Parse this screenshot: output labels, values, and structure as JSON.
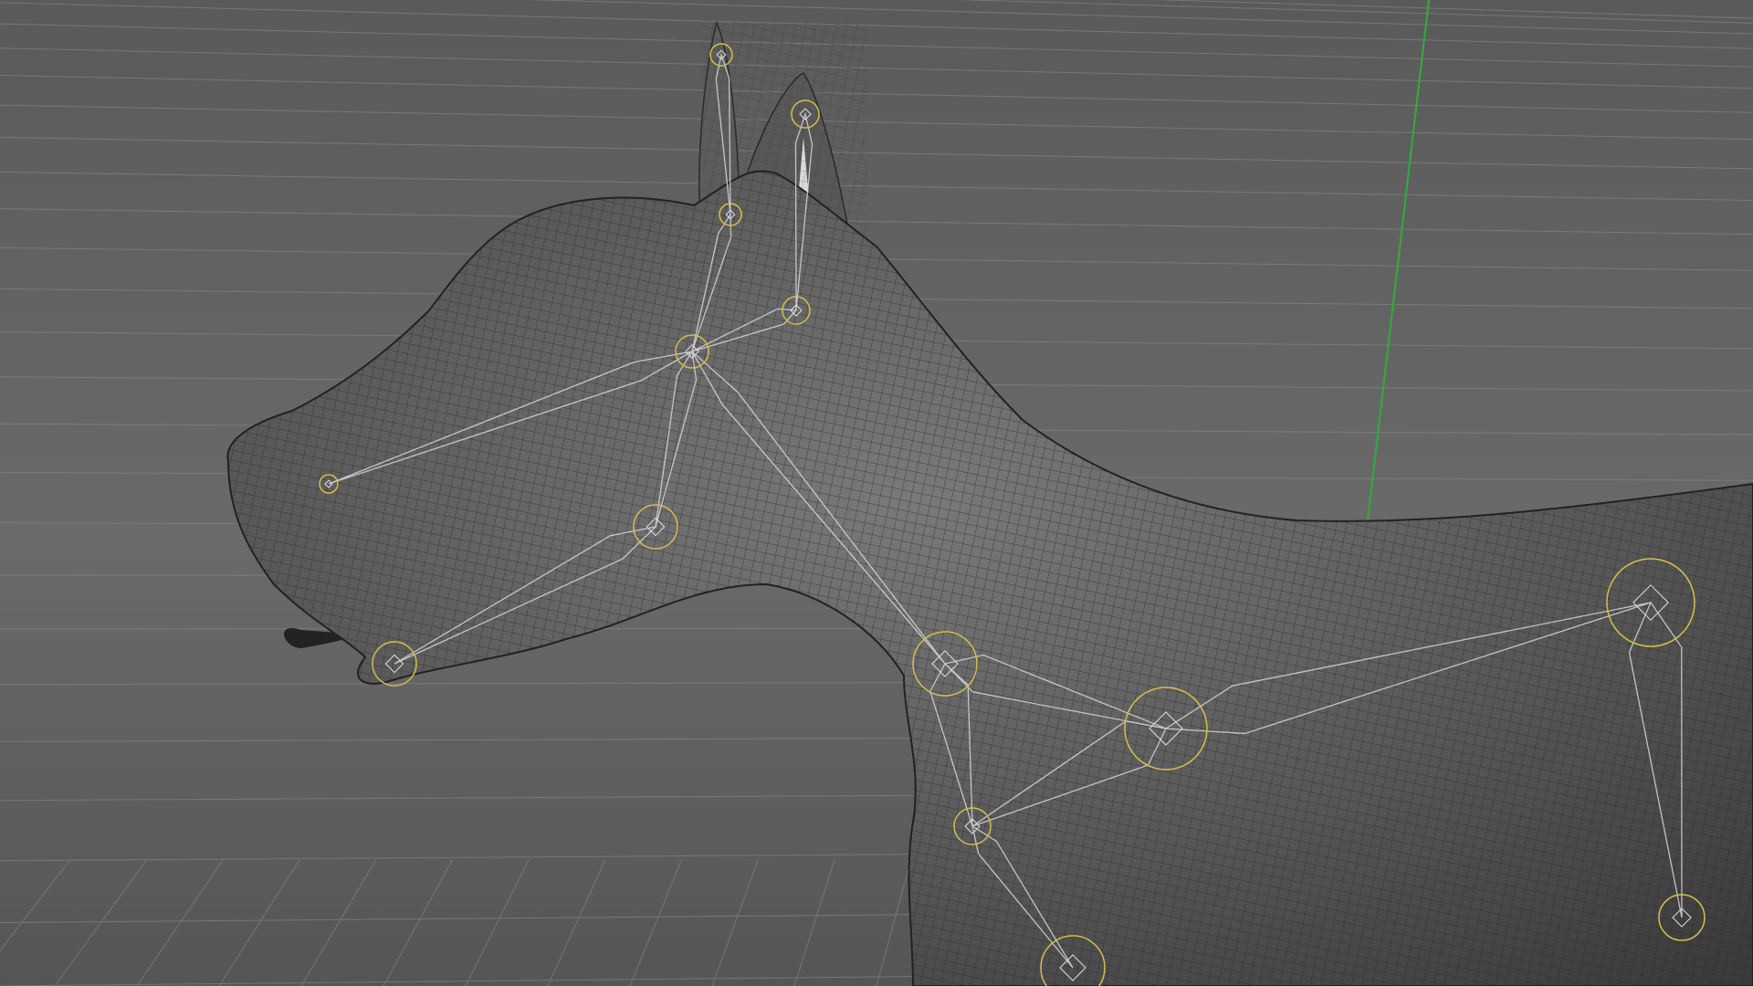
{
  "viewport": {
    "view": "perspective",
    "subject": "rigged-dog-mesh",
    "background_color": "#5e5e5e",
    "grid_color": "#8a8a8a",
    "mesh_color": "#5a5a5a",
    "mesh_wire_color": "#2a2a2a",
    "bone_color": "#d8d8d8",
    "joint_ring_color": "#d4c04a",
    "y_axis_color": "#2fae3a",
    "x_axis_color": "#c0302a"
  }
}
